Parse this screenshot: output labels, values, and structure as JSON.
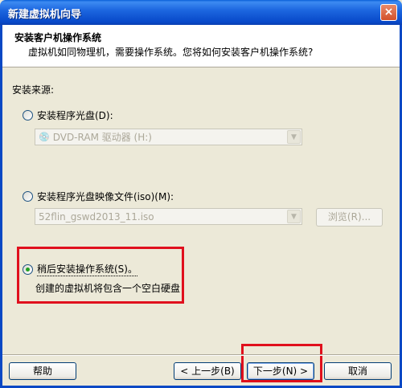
{
  "window": {
    "title": "新建虚拟机向导",
    "close_label": "×"
  },
  "header": {
    "title": "安装客户机操作系统",
    "subtitle": "虚拟机如同物理机，需要操作系统。您将如何安装客户机操作系统?"
  },
  "source_label": "安装来源:",
  "options": {
    "disc": {
      "label": "安装程序光盘(D):",
      "selected": false
    },
    "disc_combo": {
      "icon": "disc-drive-icon",
      "value": "DVD-RAM 驱动器 (H:)"
    },
    "iso": {
      "label": "安装程序光盘映像文件(iso)(M):",
      "selected": false
    },
    "iso_combo": {
      "value": "52flin_gswd2013_11.iso"
    },
    "browse_label": "浏览(R)...",
    "later": {
      "label": "稍后安装操作系统(S)。",
      "selected": true
    },
    "later_desc": "创建的虚拟机将包含一个空白硬盘"
  },
  "buttons": {
    "help": "帮助",
    "back": "< 上一步(B)",
    "next": "下一步(N) >",
    "cancel": "取消"
  },
  "colors": {
    "highlight": "#e0101d",
    "title_bar": "#0a5fd8"
  }
}
